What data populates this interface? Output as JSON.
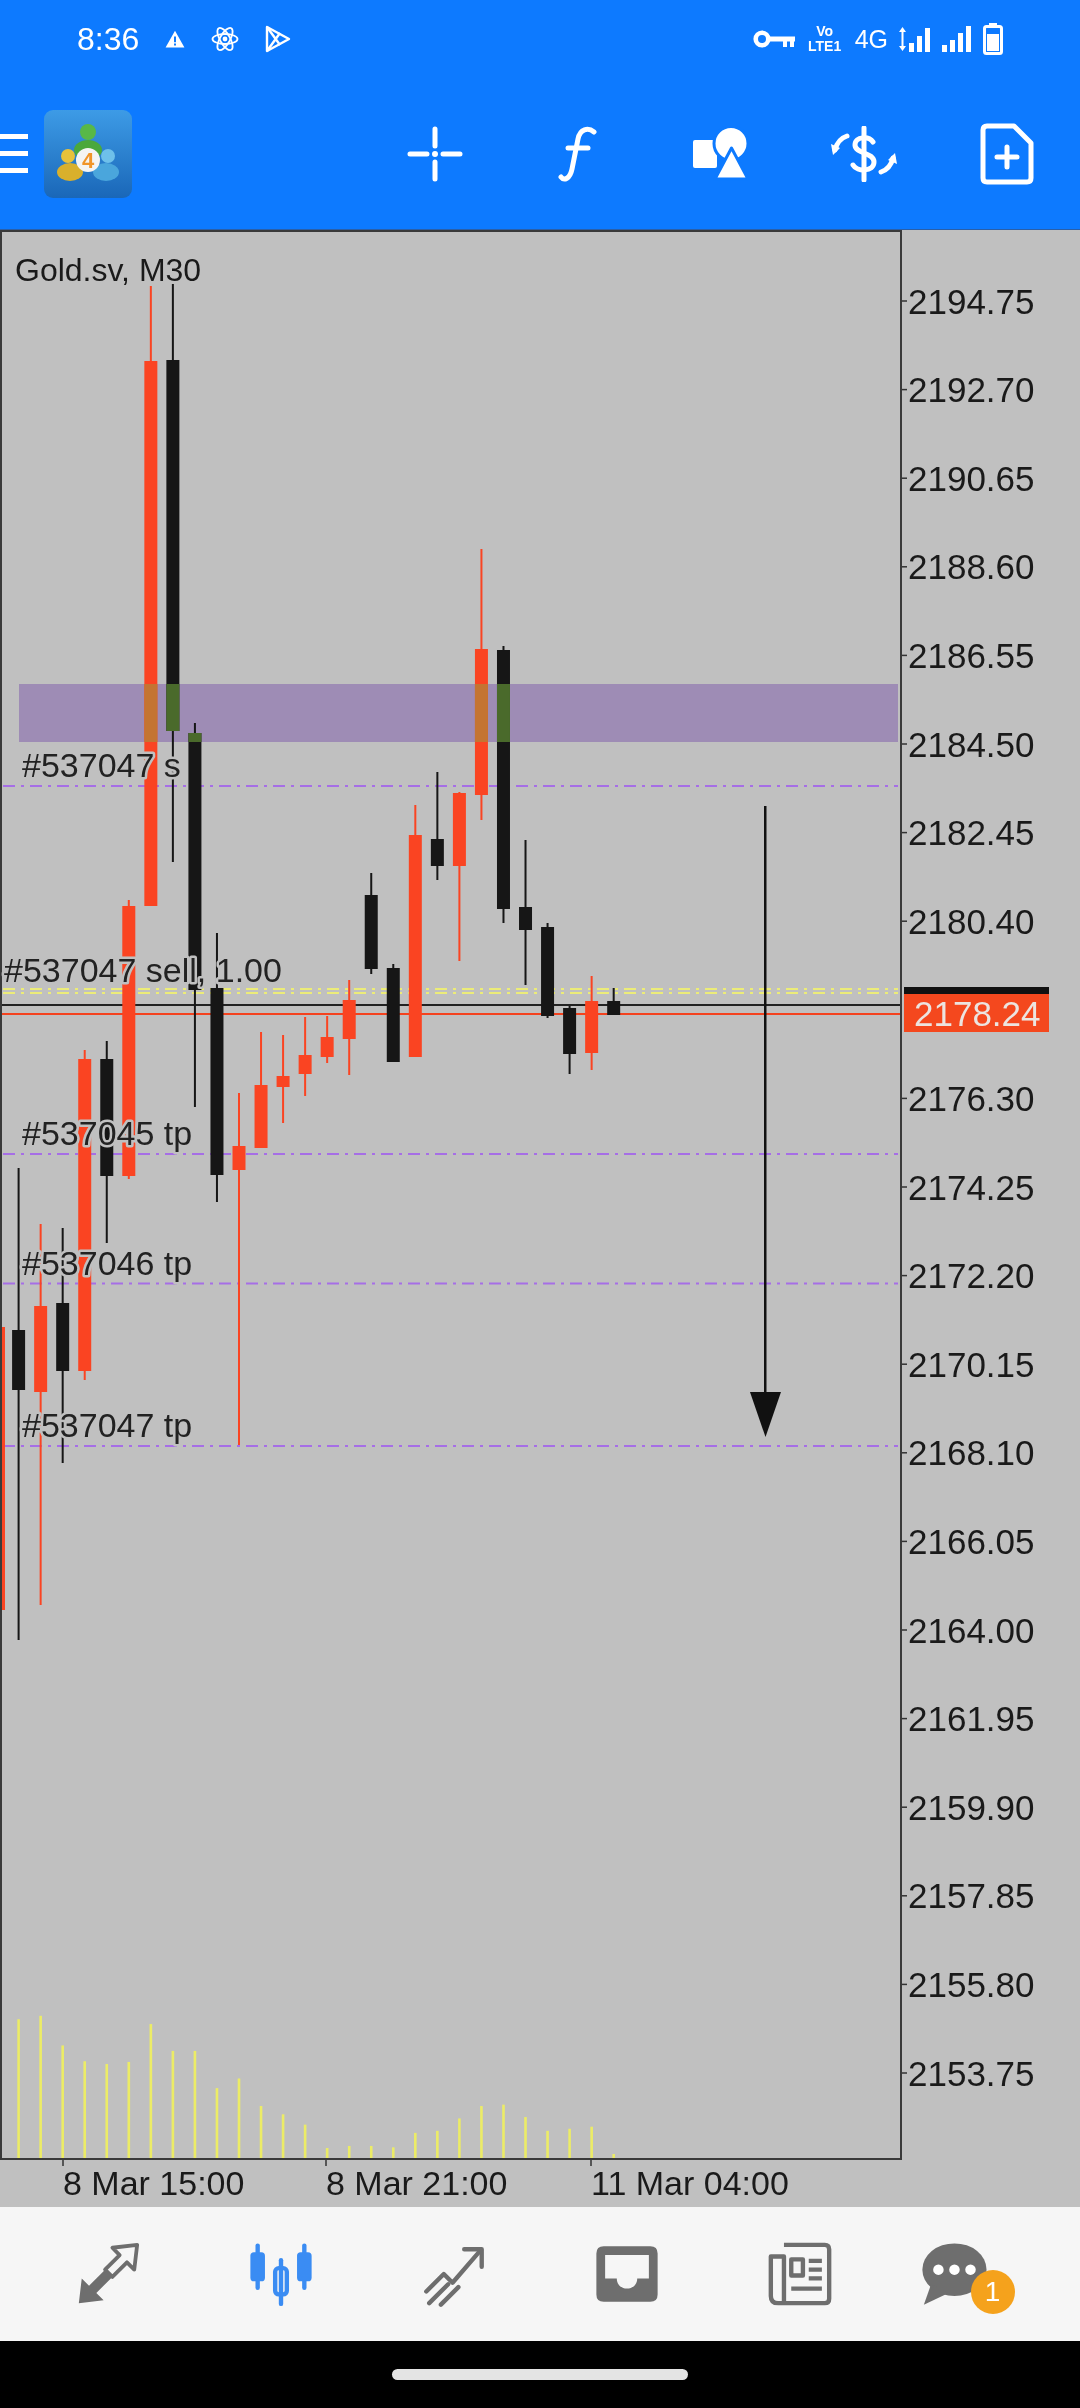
{
  "status_bar": {
    "time": "8:36",
    "volte": "Vo LTE1",
    "network": "4G"
  },
  "toolbar": {
    "logo_numeral": "4"
  },
  "chart": {
    "title": "Gold.sv, M30",
    "price_axis": [
      "2194.75",
      "2192.70",
      "2190.65",
      "2188.60",
      "2186.55",
      "2184.50",
      "2182.45",
      "2180.40",
      "2176.30",
      "2174.25",
      "2172.20",
      "2170.15",
      "2168.10",
      "2166.05",
      "2164.00",
      "2161.95",
      "2159.90",
      "2157.85",
      "2155.80",
      "2153.75"
    ],
    "current_price": "2178.24",
    "time_axis": [
      "8 Mar 15:00",
      "8 Mar 21:00",
      "11 Mar 04:00"
    ],
    "order_lines": [
      {
        "kind": "level",
        "label": "#537047 s",
        "color": "#a66ee6"
      },
      {
        "kind": "position",
        "label": "#537047 sell, 1.00",
        "color": "#ecec78"
      },
      {
        "kind": "level",
        "label": "#537045 tp",
        "color": "#a66ee6"
      },
      {
        "kind": "level",
        "label": "#537046 tp",
        "color": "#a66ee6"
      },
      {
        "kind": "level",
        "label": "#537047 tp",
        "color": "#a66ee6"
      }
    ]
  },
  "bottom_nav": [
    {
      "kind": "quotes",
      "selected": false
    },
    {
      "kind": "chart",
      "selected": true
    },
    {
      "kind": "trade",
      "selected": false
    },
    {
      "kind": "history",
      "selected": false
    },
    {
      "kind": "news",
      "selected": false
    },
    {
      "kind": "messages",
      "selected": false,
      "badge": "1"
    }
  ]
}
